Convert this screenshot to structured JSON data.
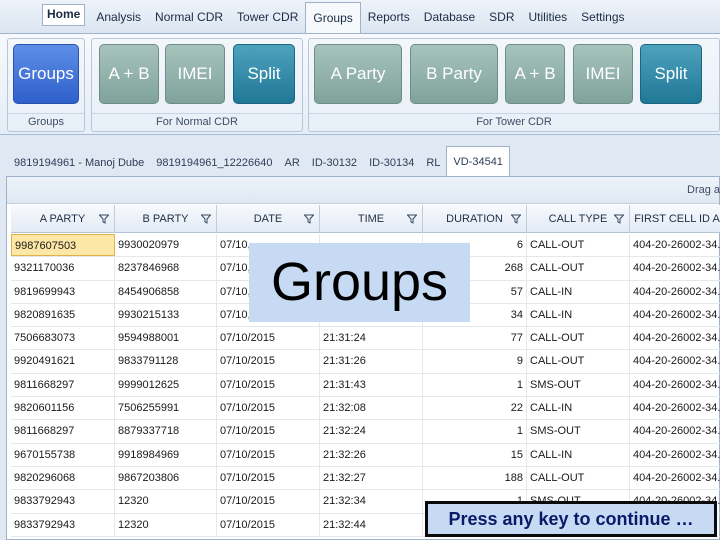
{
  "menu": {
    "items": [
      {
        "label": "Home",
        "kind": "home"
      },
      {
        "label": "Analysis",
        "kind": ""
      },
      {
        "label": "Normal CDR",
        "kind": ""
      },
      {
        "label": "Tower CDR",
        "kind": ""
      },
      {
        "label": "Groups",
        "kind": "active"
      },
      {
        "label": "Reports",
        "kind": ""
      },
      {
        "label": "Database",
        "kind": ""
      },
      {
        "label": "SDR",
        "kind": ""
      },
      {
        "label": "Utilities",
        "kind": ""
      },
      {
        "label": "Settings",
        "kind": ""
      }
    ]
  },
  "ribbon": {
    "groups": [
      {
        "label": "Groups",
        "buttons": [
          {
            "label": "Groups",
            "style": "blue"
          }
        ]
      },
      {
        "label": "For Normal CDR",
        "buttons": [
          {
            "label": "A + B",
            "style": "grey"
          },
          {
            "label": "IMEI",
            "style": "grey"
          },
          {
            "label": "Split",
            "style": "teal"
          }
        ]
      },
      {
        "label": "For Tower CDR",
        "buttons": [
          {
            "label": "A Party",
            "style": "grey"
          },
          {
            "label": "B Party",
            "style": "grey"
          },
          {
            "label": "A + B",
            "style": "grey"
          },
          {
            "label": "IMEI",
            "style": "grey"
          },
          {
            "label": "Split",
            "style": "teal"
          }
        ]
      }
    ]
  },
  "tabs": [
    {
      "label": "9819194961 - Manoj Dube",
      "active": false
    },
    {
      "label": "9819194961_12226640",
      "active": false
    },
    {
      "label": "AR",
      "active": false
    },
    {
      "label": "ID-30132",
      "active": false
    },
    {
      "label": "ID-30134",
      "active": false
    },
    {
      "label": "RL",
      "active": false
    },
    {
      "label": "VD-34541",
      "active": true
    }
  ],
  "grid": {
    "drag_hint": "Drag a",
    "columns": [
      "A PARTY",
      "B PARTY",
      "DATE",
      "TIME",
      "DURATION",
      "CALL TYPE",
      "FIRST CELL ID A"
    ],
    "rows": [
      [
        "9987607503",
        "9930020979",
        "07/10,",
        "",
        "6",
        "CALL-OUT",
        "404-20-26002-34..."
      ],
      [
        "9321170036",
        "8237846968",
        "07/10,",
        "",
        "268",
        "CALL-OUT",
        "404-20-26002-34..."
      ],
      [
        "9819699943",
        "8454906858",
        "07/10,",
        "",
        "57",
        "CALL-IN",
        "404-20-26002-34..."
      ],
      [
        "9820891635",
        "9930215133",
        "07/10,",
        "",
        "34",
        "CALL-IN",
        "404-20-26002-34..."
      ],
      [
        "7506683073",
        "9594988001",
        "07/10/2015",
        "21:31:24",
        "77",
        "CALL-OUT",
        "404-20-26002-34..."
      ],
      [
        "9920491621",
        "9833791128",
        "07/10/2015",
        "21:31:26",
        "9",
        "CALL-OUT",
        "404-20-26002-34..."
      ],
      [
        "9811668297",
        "9999012625",
        "07/10/2015",
        "21:31:43",
        "1",
        "SMS-OUT",
        "404-20-26002-34..."
      ],
      [
        "9820601156",
        "7506255991",
        "07/10/2015",
        "21:32:08",
        "22",
        "CALL-IN",
        "404-20-26002-34..."
      ],
      [
        "9811668297",
        "8879337718",
        "07/10/2015",
        "21:32:24",
        "1",
        "SMS-OUT",
        "404-20-26002-34..."
      ],
      [
        "9670155738",
        "9918984969",
        "07/10/2015",
        "21:32:26",
        "15",
        "CALL-IN",
        "404-20-26002-34..."
      ],
      [
        "9820296068",
        "9867203806",
        "07/10/2015",
        "21:32:27",
        "188",
        "CALL-OUT",
        "404-20-26002-34..."
      ],
      [
        "9833792943",
        "12320",
        "07/10/2015",
        "21:32:34",
        "1",
        "SMS-OUT",
        "404-20-26002-34..."
      ],
      [
        "9833792943",
        "12320",
        "07/10/2015",
        "21:32:44",
        "",
        "",
        ""
      ]
    ]
  },
  "overlay": {
    "title": "Groups",
    "continue_text": "Press any key to continue …"
  }
}
